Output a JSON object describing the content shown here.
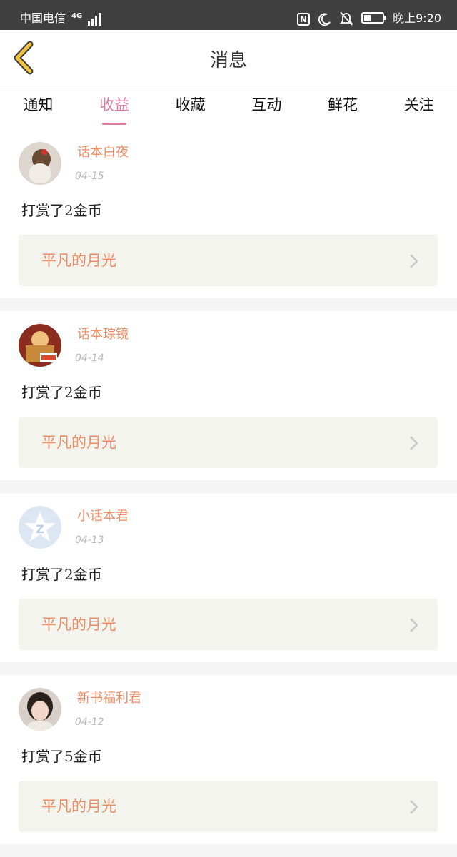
{
  "status_bar": {
    "carrier": "中国电信",
    "network": "4G",
    "time": "晚上9:20",
    "battery_level": 0.3
  },
  "header": {
    "title": "消息"
  },
  "tabs": [
    {
      "label": "通知",
      "active": false
    },
    {
      "label": "收益",
      "active": true
    },
    {
      "label": "收藏",
      "active": false
    },
    {
      "label": "互动",
      "active": false
    },
    {
      "label": "鲜花",
      "active": false
    },
    {
      "label": "关注",
      "active": false
    }
  ],
  "messages": [
    {
      "user": "话本白夜",
      "date": "04-15",
      "action": "打赏了2金币",
      "book": "平凡的月光"
    },
    {
      "user": "话本琮镜",
      "date": "04-14",
      "action": "打赏了2金币",
      "book": "平凡的月光"
    },
    {
      "user": "小话本君",
      "date": "04-13",
      "action": "打赏了2金币",
      "book": "平凡的月光"
    },
    {
      "user": "新书福利君",
      "date": "04-12",
      "action": "打赏了5金币",
      "book": "平凡的月光"
    }
  ],
  "colors": {
    "accent_pink": "#e07aa0",
    "accent_orange": "#ee8b62",
    "back_arrow": "#f0c341"
  }
}
